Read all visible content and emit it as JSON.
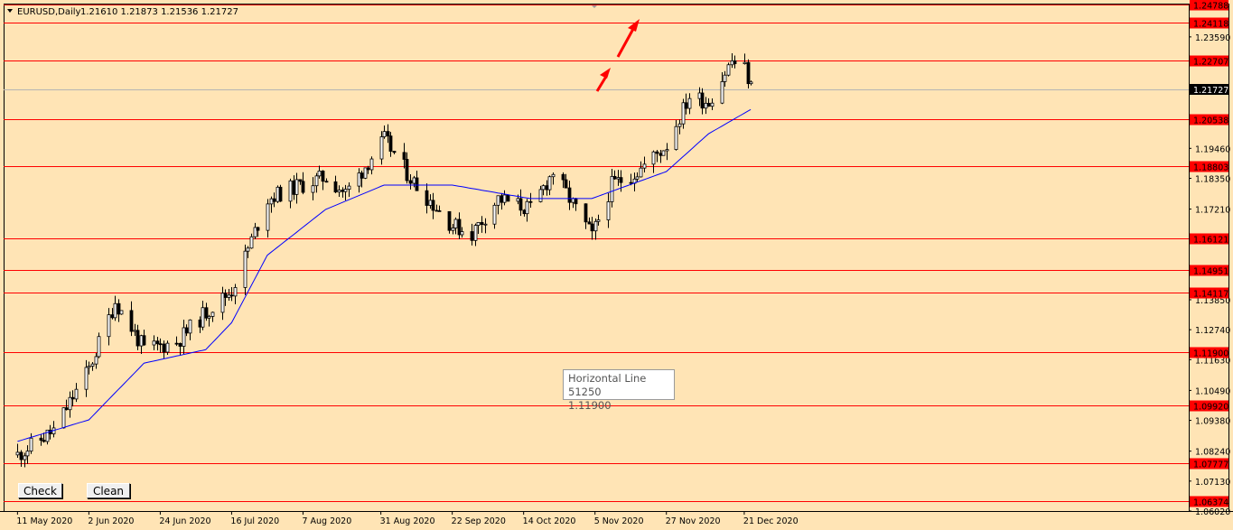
{
  "header": {
    "symbol": "EURUSD,Daily",
    "ohlc": "1.21610 1.21873 1.21536 1.21727"
  },
  "buttons": {
    "check": "Check",
    "clean": "Clean"
  },
  "tooltip": {
    "line1": "Horizontal Line 51250",
    "line2": "1.11900"
  },
  "colors": {
    "background": "#FFE4B5",
    "bull_candle": "#FFFFFF",
    "bear_candle": "#000000",
    "moving_average": "#0000FF",
    "level_line": "#FF0000",
    "arrow": "#FF0000"
  },
  "chart_data": {
    "type": "candlestick",
    "title": "EURUSD,Daily",
    "ylim": [
      1.0602,
      1.2479
    ],
    "y_ticks": [
      "1.23590",
      "1.19460",
      "1.18350",
      "1.17210",
      "1.13850",
      "1.12740",
      "1.11630",
      "1.10490",
      "1.09380",
      "1.08240",
      "1.07130",
      "1.06020"
    ],
    "current_price": "1.21727",
    "x_ticks": [
      "11 May 2020",
      "2 Jun 2020",
      "24 Jun 2020",
      "16 Jul 2020",
      "7 Aug 2020",
      "31 Aug 2020",
      "22 Sep 2020",
      "14 Oct 2020",
      "5 Nov 2020",
      "27 Nov 2020",
      "21 Dec 2020"
    ],
    "horizontal_levels": [
      "1.24788",
      "1.24118",
      "1.22707",
      "1.20538",
      "1.18803",
      "1.16121",
      "1.14951",
      "1.14117",
      "1.11900",
      "1.09920",
      "1.07777",
      "1.06374"
    ],
    "series": [
      {
        "name": "Price",
        "path": [
          [
            "2020-05-11",
            1.081
          ],
          [
            "2020-05-22",
            1.09
          ],
          [
            "2020-06-02",
            1.113
          ],
          [
            "2020-06-10",
            1.138
          ],
          [
            "2020-06-19",
            1.12
          ],
          [
            "2020-06-29",
            1.123
          ],
          [
            "2020-07-08",
            1.134
          ],
          [
            "2020-07-16",
            1.142
          ],
          [
            "2020-07-27",
            1.176
          ],
          [
            "2020-08-04",
            1.18
          ],
          [
            "2020-08-14",
            1.184
          ],
          [
            "2020-08-20",
            1.178
          ],
          [
            "2020-09-01",
            1.198
          ],
          [
            "2020-09-10",
            1.182
          ],
          [
            "2020-09-22",
            1.166
          ],
          [
            "2020-09-28",
            1.163
          ],
          [
            "2020-10-06",
            1.176
          ],
          [
            "2020-10-16",
            1.172
          ],
          [
            "2020-10-23",
            1.186
          ],
          [
            "2020-11-04",
            1.162
          ],
          [
            "2020-11-10",
            1.181
          ],
          [
            "2020-11-18",
            1.186
          ],
          [
            "2020-11-27",
            1.196
          ],
          [
            "2020-12-04",
            1.214
          ],
          [
            "2020-12-10",
            1.212
          ],
          [
            "2020-12-17",
            1.227
          ],
          [
            "2020-12-21",
            1.224
          ],
          [
            "2020-12-23",
            1.2173
          ]
        ]
      },
      {
        "name": "Moving Average",
        "path": [
          [
            "2020-05-11",
            1.086
          ],
          [
            "2020-06-02",
            1.094
          ],
          [
            "2020-06-19",
            1.115
          ],
          [
            "2020-07-08",
            1.12
          ],
          [
            "2020-07-16",
            1.13
          ],
          [
            "2020-07-27",
            1.155
          ],
          [
            "2020-08-14",
            1.172
          ],
          [
            "2020-09-01",
            1.181
          ],
          [
            "2020-09-22",
            1.181
          ],
          [
            "2020-10-16",
            1.176
          ],
          [
            "2020-11-04",
            1.176
          ],
          [
            "2020-11-27",
            1.186
          ],
          [
            "2020-12-10",
            1.2
          ],
          [
            "2020-12-23",
            1.209
          ]
        ]
      }
    ]
  }
}
